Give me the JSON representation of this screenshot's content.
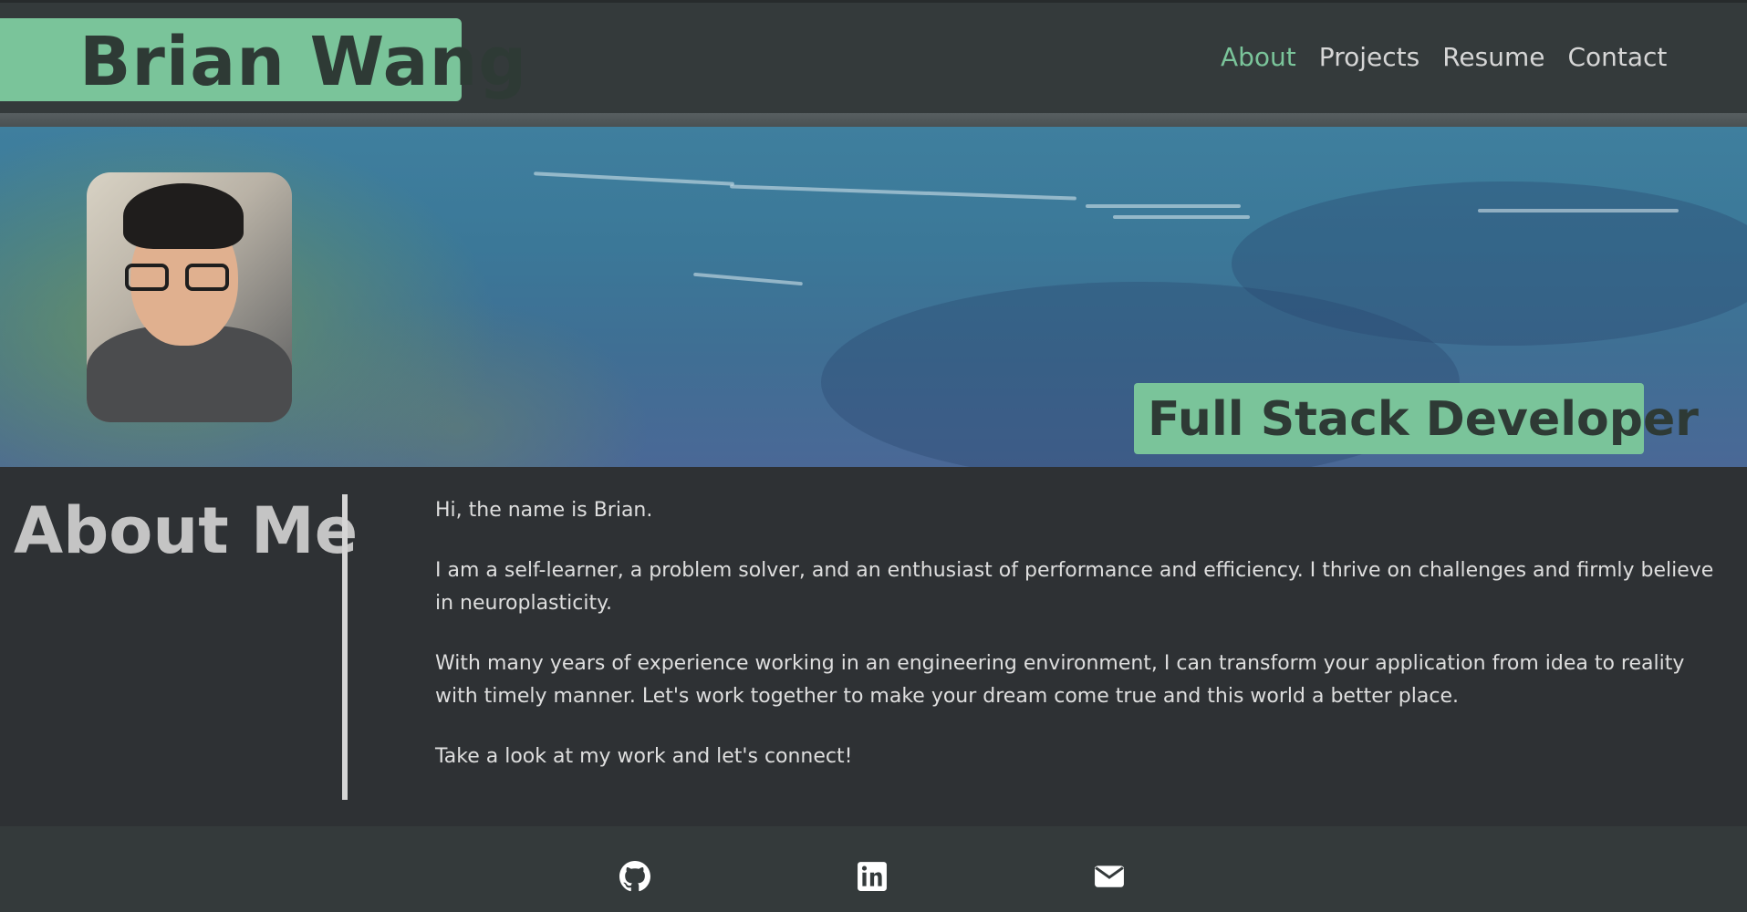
{
  "header": {
    "logo_text": "Brian Wang",
    "nav": [
      {
        "label": "About",
        "active": true
      },
      {
        "label": "Projects",
        "active": false
      },
      {
        "label": "Resume",
        "active": false
      },
      {
        "label": "Contact",
        "active": false
      }
    ]
  },
  "hero": {
    "role": "Full Stack Developer"
  },
  "about": {
    "title": "About Me",
    "paragraphs": [
      "Hi, the name is Brian.",
      "I am a self-learner, a problem solver, and an enthusiast of performance and efficiency. I thrive on challenges and firmly believe in neuroplasticity.",
      "With many years of experience working in an engineering environment, I can transform your application from idea to reality with timely manner. Let's work together to make your dream come true and this world a better place.",
      "Take a look at my work and let's connect!"
    ]
  },
  "footer": {
    "icons": [
      "github-icon",
      "linkedin-icon",
      "email-icon"
    ]
  },
  "colors": {
    "accent": "#7ac49a",
    "header_bg": "#343a3b",
    "body_bg": "#2e3134"
  }
}
